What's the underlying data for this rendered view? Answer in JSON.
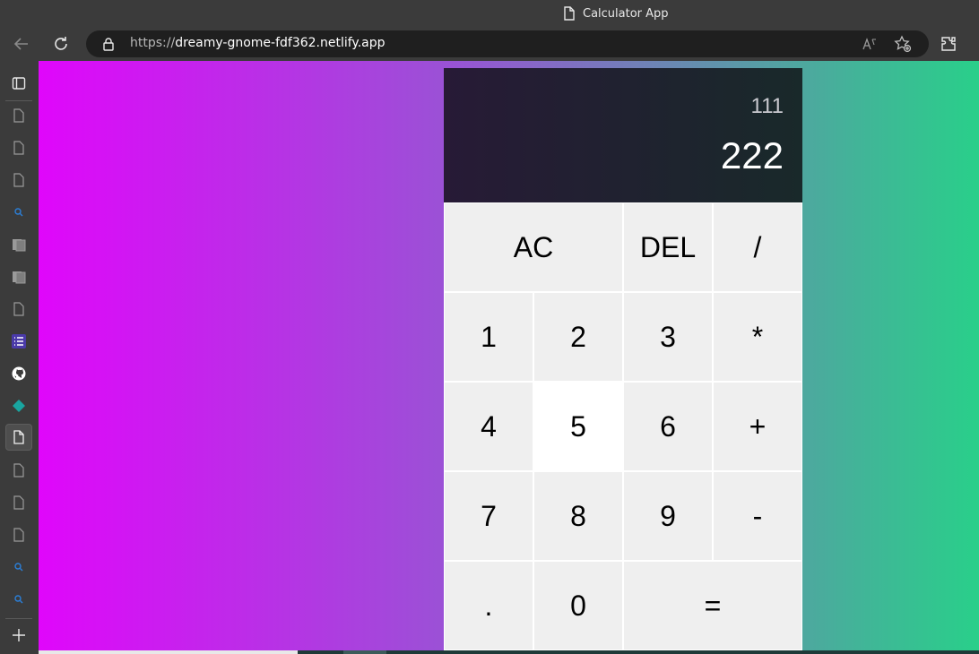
{
  "browser": {
    "tab_title": "Calculator App",
    "url_scheme": "https://",
    "url_host": "dreamy-gnome-fdf362.netlify.app",
    "toolbar_icons": [
      "back-icon",
      "refresh-icon",
      "lock-icon",
      "read-aloud-icon",
      "add-favorite-icon",
      "extensions-icon"
    ],
    "sidebar_icons": [
      "tab-actions-icon",
      "page-icon",
      "page-icon",
      "page-icon",
      "search-icon",
      "pages-icon",
      "pages-icon",
      "page-icon",
      "list-icon",
      "github-icon",
      "diamond-icon",
      "page-icon",
      "page-icon",
      "page-icon",
      "page-icon",
      "search-icon",
      "search-icon",
      "new-tab-icon"
    ]
  },
  "calculator": {
    "previous_operand": "111",
    "current_operand": "222",
    "keys": {
      "ac": "AC",
      "del": "DEL",
      "divide": "/",
      "one": "1",
      "two": "2",
      "three": "3",
      "multiply": "*",
      "four": "4",
      "five": "5",
      "six": "6",
      "plus": "+",
      "seven": "7",
      "eight": "8",
      "nine": "9",
      "minus": "-",
      "dot": ".",
      "zero": "0",
      "equals": "="
    }
  },
  "colors": {
    "gradient_start": "#e006fb",
    "gradient_end": "#29cf8a",
    "display_bg": "#271a36",
    "key_bg": "#efefef",
    "key_hover_bg": "#ffffff"
  }
}
